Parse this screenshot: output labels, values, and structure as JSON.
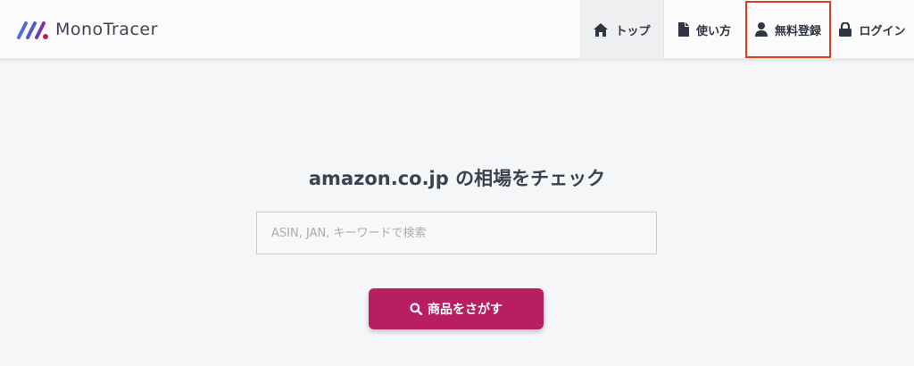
{
  "app": {
    "logo_text": "MonoTracer"
  },
  "nav": {
    "items": [
      {
        "label": "トップ",
        "icon": "home-icon"
      },
      {
        "label": "使い方",
        "icon": "document-icon"
      },
      {
        "label": "無料登録",
        "icon": "user-icon"
      },
      {
        "label": "ログイン",
        "icon": "lock-icon"
      }
    ]
  },
  "main": {
    "title": "amazon.co.jp の相場をチェック",
    "search_placeholder": "ASIN, JAN, キーワードで検索",
    "search_value": "",
    "search_button_label": "商品をさがす",
    "search_button_icon": "search-icon"
  },
  "colors": {
    "accent": "#b71f62",
    "highlight_border": "#d9411e",
    "background": "#f5f6f8",
    "logo_blue": "#4a6ee0",
    "logo_magenta": "#b71f62"
  }
}
